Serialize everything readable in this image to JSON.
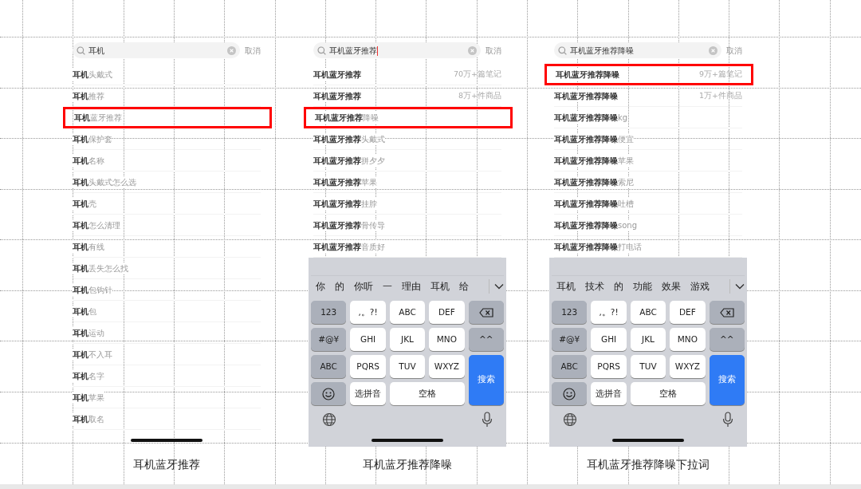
{
  "panels": [
    {
      "search": {
        "value": "耳机",
        "cancel": "取消"
      },
      "suggestions": [
        {
          "text": "**耳机**头戴式",
          "highlighted": false
        },
        {
          "text": "**耳机**推荐",
          "highlighted": false
        },
        {
          "text": "**耳机**蓝牙推荐",
          "highlighted": true
        },
        {
          "text": "**耳机**保护套",
          "highlighted": false
        },
        {
          "text": "**耳机**名称",
          "highlighted": false
        },
        {
          "text": "**耳机**头戴式怎么选",
          "highlighted": false
        },
        {
          "text": "**耳机**壳",
          "highlighted": false
        },
        {
          "text": "**耳机**怎么清理",
          "highlighted": false
        },
        {
          "text": "**耳机**有线",
          "highlighted": false
        },
        {
          "text": "**耳机**丢失怎么找",
          "highlighted": false
        },
        {
          "text": "**耳机**包钩针",
          "highlighted": false
        },
        {
          "text": "**耳机**包",
          "highlighted": false
        },
        {
          "text": "**耳机**运动",
          "highlighted": false
        },
        {
          "text": "**耳机**不入耳",
          "highlighted": false
        },
        {
          "text": "**耳机**名字",
          "highlighted": false
        },
        {
          "text": "**耳机**苹果",
          "highlighted": false
        },
        {
          "text": "**耳机**取名",
          "highlighted": false
        }
      ],
      "caption": "耳机蓝牙推荐"
    },
    {
      "search": {
        "value": "耳机蓝牙推荐",
        "cursor": true,
        "cancel": "取消"
      },
      "suggestions": [
        {
          "text": "**耳机蓝牙推荐**",
          "count": "70万+篇笔记",
          "highlighted": false
        },
        {
          "text": "**耳机蓝牙推荐**",
          "count": "8万+件商品",
          "highlighted": false
        },
        {
          "text": "**耳机蓝牙推荐**降噪",
          "highlighted": true
        },
        {
          "text": "**耳机蓝牙推荐**头戴式",
          "highlighted": false
        },
        {
          "text": "**耳机蓝牙推荐**拼夕夕",
          "highlighted": false
        },
        {
          "text": "**耳机蓝牙推荐**苹果",
          "highlighted": false
        },
        {
          "text": "**耳机蓝牙推荐**挂脖",
          "highlighted": false
        },
        {
          "text": "**耳机蓝牙推荐**骨传导",
          "highlighted": false
        },
        {
          "text": "**耳机蓝牙推荐**音质好",
          "highlighted": false
        }
      ],
      "keyboard": {
        "candidates": [
          "你",
          "的",
          "你听",
          "一",
          "理由",
          "耳机",
          "给"
        ],
        "keys": [
          {
            "kind": "function",
            "label": "123"
          },
          {
            "kind": "letter",
            "label": ",。?!"
          },
          {
            "kind": "letter",
            "label": "ABC"
          },
          {
            "kind": "letter",
            "label": "DEF"
          },
          {
            "kind": "delete"
          },
          {
            "kind": "function",
            "label": "#@¥"
          },
          {
            "kind": "letter",
            "label": "GHI"
          },
          {
            "kind": "letter",
            "label": "JKL"
          },
          {
            "kind": "letter",
            "label": "MNO"
          },
          {
            "kind": "function",
            "label": "^^"
          },
          {
            "kind": "function",
            "label": "ABC"
          },
          {
            "kind": "letter",
            "label": "PQRS"
          },
          {
            "kind": "letter",
            "label": "TUV"
          },
          {
            "kind": "letter",
            "label": "WXYZ"
          },
          {
            "kind": "search",
            "label": "搜索"
          },
          {
            "kind": "emoji"
          },
          {
            "kind": "letter",
            "label": "选拼音"
          },
          {
            "kind": "space",
            "label": "空格"
          }
        ]
      },
      "caption": "耳机蓝牙推荐降噪"
    },
    {
      "search": {
        "value": "耳机蓝牙推荐降噪",
        "cancel": "取消"
      },
      "suggestions": [
        {
          "text": "**耳机蓝牙推荐降噪**",
          "count": "9万+篇笔记",
          "highlighted": true
        },
        {
          "text": "**耳机蓝牙推荐降噪**",
          "count": "1万+件商品",
          "highlighted": false
        },
        {
          "text": "**耳机蓝牙推荐降噪**kg",
          "highlighted": false
        },
        {
          "text": "**耳机蓝牙推荐降噪**便宜",
          "highlighted": false
        },
        {
          "text": "**耳机蓝牙推荐降噪**苹果",
          "highlighted": false
        },
        {
          "text": "**耳机蓝牙推荐降噪**索尼",
          "highlighted": false
        },
        {
          "text": "**耳机蓝牙推荐降噪**吐槽",
          "highlighted": false
        },
        {
          "text": "**耳机蓝牙推荐降噪**song",
          "highlighted": false
        },
        {
          "text": "**耳机蓝牙推荐降噪**打电话",
          "highlighted": false
        }
      ],
      "keyboard": {
        "candidates": [
          "耳机",
          "技术",
          "的",
          "功能",
          "效果",
          "游戏"
        ],
        "keys": [
          {
            "kind": "function",
            "label": "123"
          },
          {
            "kind": "letter",
            "label": ",。?!"
          },
          {
            "kind": "letter",
            "label": "ABC"
          },
          {
            "kind": "letter",
            "label": "DEF"
          },
          {
            "kind": "delete"
          },
          {
            "kind": "function",
            "label": "#@¥"
          },
          {
            "kind": "letter",
            "label": "GHI"
          },
          {
            "kind": "letter",
            "label": "JKL"
          },
          {
            "kind": "letter",
            "label": "MNO"
          },
          {
            "kind": "function",
            "label": "^^"
          },
          {
            "kind": "function",
            "label": "ABC"
          },
          {
            "kind": "letter",
            "label": "PQRS"
          },
          {
            "kind": "letter",
            "label": "TUV"
          },
          {
            "kind": "letter",
            "label": "WXYZ"
          },
          {
            "kind": "search",
            "label": "搜索"
          },
          {
            "kind": "emoji"
          },
          {
            "kind": "letter",
            "label": "选拼音"
          },
          {
            "kind": "space",
            "label": "空格"
          }
        ]
      },
      "caption": "耳机蓝牙推荐降噪下拉词"
    }
  ]
}
